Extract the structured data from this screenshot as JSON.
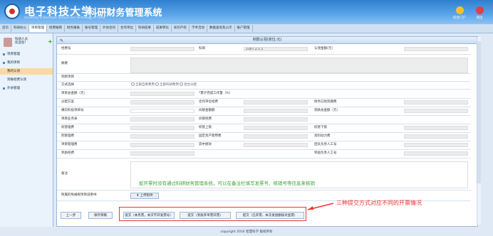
{
  "header": {
    "school_name": "电子科技大学",
    "school_en": "University of Electronic Science and Technology of China",
    "system_name": "-科研财务管理系统",
    "icons": [
      {
        "name": "home-icon",
        "label": "综合门户",
        "color": "#f2c12e"
      },
      {
        "name": "logout-icon",
        "label": "退出",
        "color": "#e04040"
      }
    ]
  },
  "nav": {
    "items": [
      "首页",
      "科研办公",
      "项目管理",
      "经费报销",
      "财务报账",
      "账号管理",
      "外协合同",
      "合作单位",
      "科研成果",
      "成果转化",
      "知识产权",
      "学术活动",
      "数据查询及公示",
      "账户管理"
    ],
    "active_index": 2
  },
  "sidebar": {
    "user_line1": "科研人员",
    "user_line2": "欢迎您！",
    "items": [
      {
        "label": "项目管理",
        "highlight": false
      },
      {
        "label": "我的项目",
        "highlight": false
      },
      {
        "label": "我的认领",
        "highlight": true
      },
      {
        "label": "到账经费认领",
        "highlight": false
      },
      {
        "label": "外协管理",
        "highlight": false
      }
    ]
  },
  "panel": {
    "title": "到款认领(单位:元)",
    "rows": {
      "r1": {
        "l1": "经费号",
        "l2": "科目",
        "v2": "2307.2.1.1",
        "l3": "认领金额(元)"
      },
      "r2": {
        "l1": "摘要"
      },
      "r3": {
        "l1": "到款项目"
      },
      "r4": {
        "l1": "方式选择",
        "opt1": "全部自筹费用",
        "opt2": "全部科研费用",
        "opt3": "混合分配"
      },
      "r5": {
        "l1": "项目总金额（元）",
        "l2": "*累计完成工作量（%）"
      },
      "r6": {
        "l1": "分配方案",
        "l2": "合作单位经费",
        "l3": "财务已经到期费"
      },
      "r7": {
        "l1": "横向科技项目号",
        "l2": "间接金额额",
        "l3": "到款总金额（元）"
      },
      "r8": {
        "l1": "项目业务表",
        "l2": "间接经费"
      },
      "r9": {
        "l1": "校管理费",
        "l2": "校管上限",
        "l3": "校管下限"
      },
      "r10": {
        "l1": "院管理费",
        "l2": "固定资产使用费",
        "l3": "资料动力费"
      },
      "r11": {
        "l1": "项目管理费",
        "l2": "其中绩效",
        "l3": "团队负责人工号"
      },
      "r12": {
        "l1": "奖励经费",
        "l3": "奖励负责人工号"
      },
      "r13": {
        "l1": "备注"
      },
      "r14": {
        "l1": "附属的免报税项目说明书"
      }
    },
    "upload_label": "上传附件",
    "note": "如开票时没有通过科研财务管理系统，可以在备注栏填写发票号、核销号等信息来核销",
    "buttons": {
      "prev": "上一步",
      "save": "保存草稿",
      "submit1": "提交（本月票，本次不开发票号）",
      "submit2": "提交（到款开单票开票）",
      "submit3": "提交（已开票，本次发放额核对查票）"
    }
  },
  "annotation": {
    "callout": "三种提交方式对应不同的开票情况",
    "color": "#e33333"
  },
  "footer": {
    "copyright": "copyright 2016 智慧科学 版权所有"
  },
  "colors": {
    "header_blue": "#2f7fd0",
    "sidebar_highlight": "#fbd9a0",
    "note_green": "#3aa335"
  }
}
